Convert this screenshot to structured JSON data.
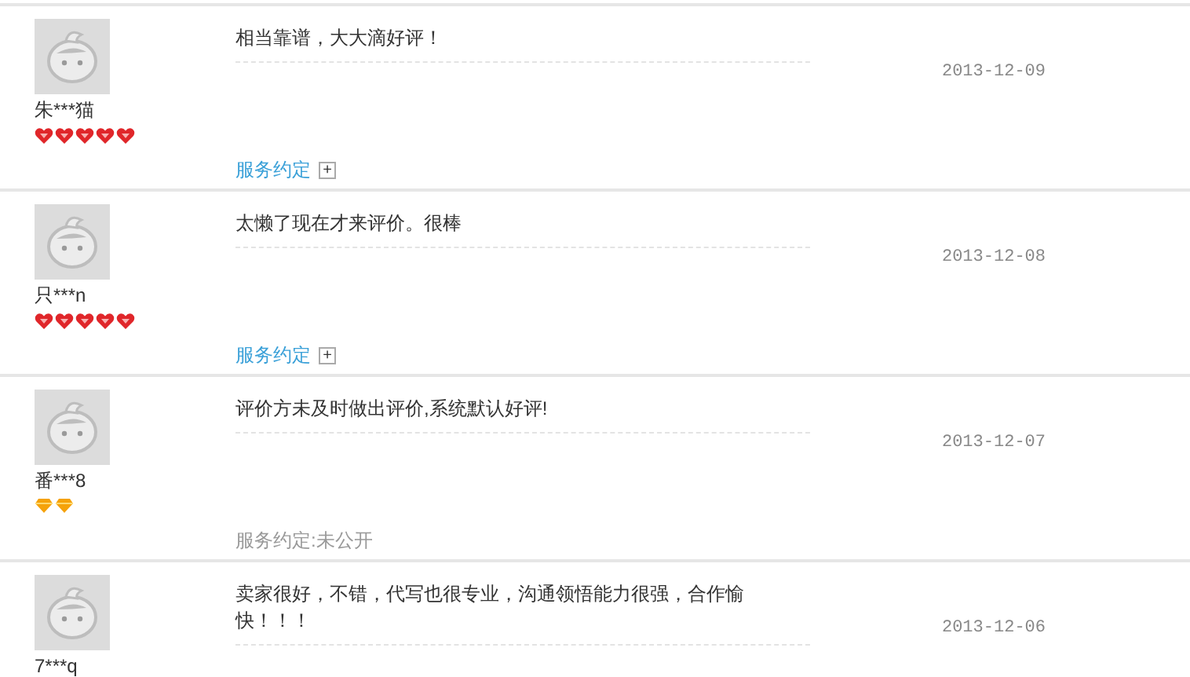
{
  "reviews": [
    {
      "user": "朱***猫",
      "rank_icons": [
        {
          "kind": "heart"
        },
        {
          "kind": "heart"
        },
        {
          "kind": "heart"
        },
        {
          "kind": "heart"
        },
        {
          "kind": "heart"
        }
      ],
      "comment": "相当靠谱，大大滴好评！",
      "date": "2013-12-09",
      "service": {
        "kind": "link",
        "label": "服务约定",
        "toggle": "+"
      }
    },
    {
      "user": "只***n",
      "rank_icons": [
        {
          "kind": "heart"
        },
        {
          "kind": "heart"
        },
        {
          "kind": "heart"
        },
        {
          "kind": "heart"
        },
        {
          "kind": "heart"
        }
      ],
      "comment": "太懒了现在才来评价。很棒",
      "date": "2013-12-08",
      "service": {
        "kind": "link",
        "label": "服务约定",
        "toggle": "+"
      }
    },
    {
      "user": "番***8",
      "rank_icons": [
        {
          "kind": "diamond"
        },
        {
          "kind": "diamond"
        }
      ],
      "comment": "评价方未及时做出评价,系统默认好评!",
      "date": "2013-12-07",
      "service": {
        "kind": "text",
        "label": "服务约定:未公开"
      }
    },
    {
      "user": "7***q",
      "comment": "卖家很好，不错，代写也很专业，沟通领悟能力很强，合作愉快！！！",
      "date": "2013-12-06"
    }
  ]
}
